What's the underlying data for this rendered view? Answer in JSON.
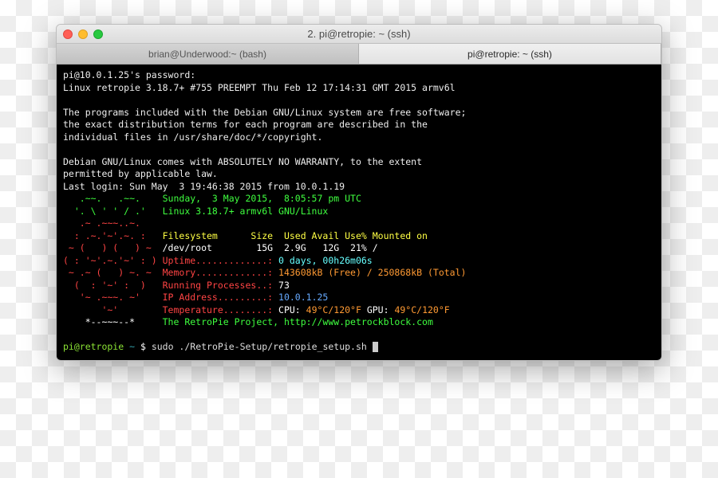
{
  "window": {
    "title": "2. pi@retropie: ~ (ssh)"
  },
  "tabs": [
    {
      "label": "brian@Underwood:~ (bash)",
      "active": false
    },
    {
      "label": "pi@retropie: ~ (ssh)",
      "active": true
    }
  ],
  "login": {
    "pwprompt": "pi@10.0.1.25's password:",
    "uname": "Linux retropie 3.18.7+ #755 PREEMPT Thu Feb 12 17:14:31 GMT 2015 armv6l",
    "motd1": "The programs included with the Debian GNU/Linux system are free software;",
    "motd2": "the exact distribution terms for each program are described in the",
    "motd3": "individual files in /usr/share/doc/*/copyright.",
    "motd4": "Debian GNU/Linux comes with ABSOLUTELY NO WARRANTY, to the extent",
    "motd5": "permitted by applicable law.",
    "lastlogin": "Last login: Sun May  3 19:46:38 2015 from 10.0.1.19"
  },
  "art": {
    "l1": "   .~~.   .~~.    ",
    "l2": "  '. \\ ' ' / .'   ",
    "l3": "   .~ .~~~..~.    ",
    "l4": "  : .~.'~'.~. :   ",
    "l5": " ~ (   ) (   ) ~  ",
    "l6": "( : '~'.~.'~' : ) ",
    "l7": " ~ .~ (   ) ~. ~  ",
    "l8": "  (  : '~' :  )   ",
    "l9": "   '~ .~~~. ~'    ",
    "l10": "       '~'        ",
    "l11": "    *--~~~--*     "
  },
  "info": {
    "date": "Sunday,  3 May 2015,  8:05:57 pm UTC",
    "kernel": "Linux 3.18.7+ armv6l GNU/Linux",
    "fs_header": "Filesystem      Size  Used Avail Use% Mounted on",
    "fs_row": "/dev/root        15G  2.9G   12G  21% /",
    "uptime_lbl": "Uptime.............: ",
    "uptime_val": "0 days, 00h26m06s",
    "memory_lbl": "Memory.............: ",
    "memory_val": "143608kB (Free) / 250868kB (Total)",
    "procs_lbl": "Running Processes..: ",
    "procs_val": "73",
    "ip_lbl": "IP Address.........: ",
    "ip_val": "10.0.1.25",
    "temp_lbl": "Temperature........: ",
    "temp_cpu_l": "CPU: ",
    "temp_cpu_v": "49°C/120°F",
    "temp_gpu_l": " GPU: ",
    "temp_gpu_v": "49°C/120°F",
    "project": "The RetroPie Project, http://www.petrockblock.com"
  },
  "prompt": {
    "user": "pi@retropie",
    "path": " ~ ",
    "sym": "$ ",
    "cmd": "sudo ./RetroPie-Setup/retropie_setup.sh "
  }
}
